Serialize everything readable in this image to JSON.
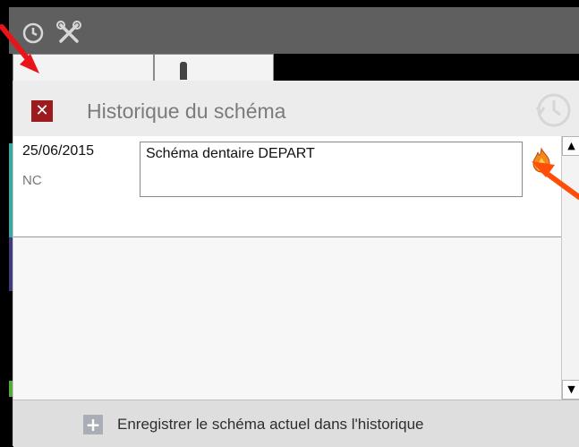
{
  "colors": {
    "close_red": "#9b1b1f",
    "annotation_red": "#e8141a",
    "annotation_orange": "#ff4d0a"
  },
  "header": {
    "title": "Historique du schéma",
    "close_icon": "close-x-icon",
    "history_icon": "history-clock-icon"
  },
  "entry": {
    "date": "25/06/2015",
    "status": "NC",
    "description": "Schéma dentaire DEPART",
    "action_icon": "fire-icon"
  },
  "scrollbar": {
    "up_glyph": "▲",
    "down_glyph": "▼"
  },
  "footer": {
    "add_icon_glyph": "+",
    "label": "Enregistrer le schéma actuel dans l'historique"
  }
}
